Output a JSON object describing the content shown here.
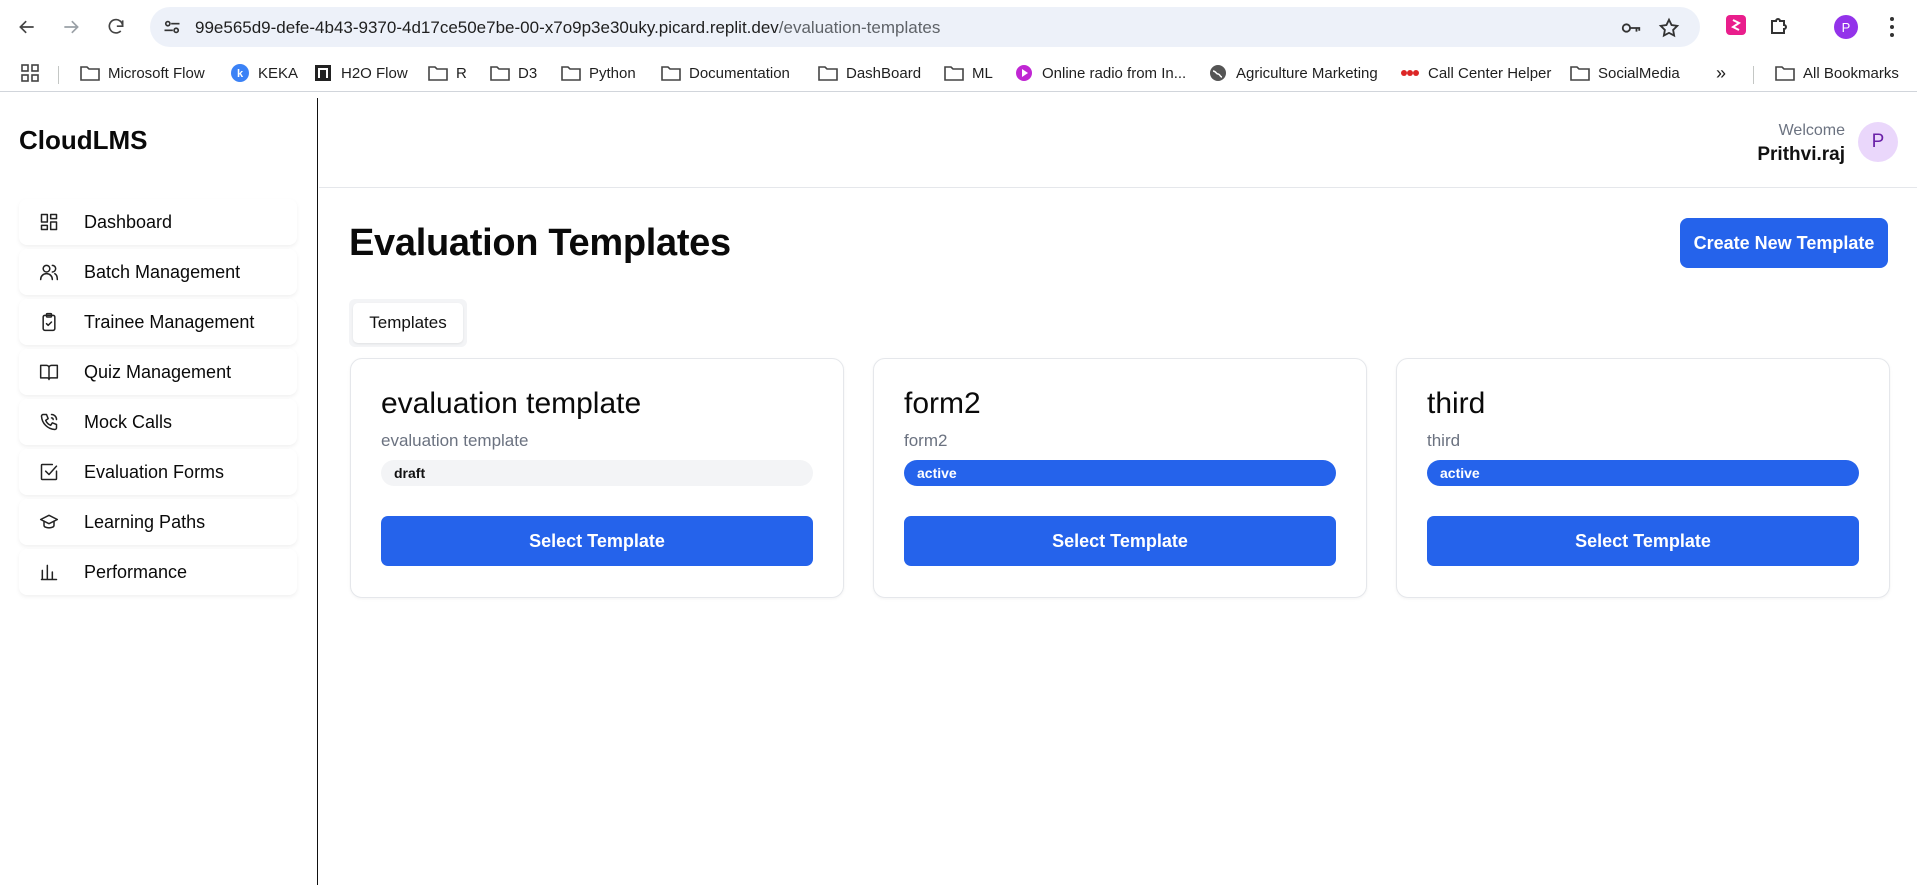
{
  "browser": {
    "url_host": "99e565d9-defe-4b43-9370-4d17ce50e7be-00-x7o9p3e30uky.picard.replit.dev",
    "url_path": "/evaluation-templates",
    "profile_initial": "P",
    "bookmarks": [
      {
        "label": "Microsoft Flow",
        "icon": "folder-icon"
      },
      {
        "label": "KEKA",
        "icon": "keka-icon"
      },
      {
        "label": "H2O Flow",
        "icon": "h2o-icon"
      },
      {
        "label": "R",
        "icon": "folder-icon"
      },
      {
        "label": "D3",
        "icon": "folder-icon"
      },
      {
        "label": "Python",
        "icon": "folder-icon"
      },
      {
        "label": "Documentation",
        "icon": "folder-icon"
      },
      {
        "label": "DashBoard",
        "icon": "folder-icon"
      },
      {
        "label": "ML",
        "icon": "folder-icon"
      },
      {
        "label": "Online radio from In...",
        "icon": "radio-icon"
      },
      {
        "label": "Agriculture Marketing",
        "icon": "globe-icon"
      },
      {
        "label": "Call Center Helper",
        "icon": "callcenter-icon"
      },
      {
        "label": "SocialMedia",
        "icon": "folder-icon"
      }
    ],
    "all_bookmarks": "All Bookmarks",
    "accent_color": "#2563eb"
  },
  "app": {
    "brand": "CloudLMS",
    "nav": [
      {
        "label": "Dashboard",
        "icon": "grid-icon"
      },
      {
        "label": "Batch Management",
        "icon": "users-icon"
      },
      {
        "label": "Trainee Management",
        "icon": "clipboard-icon"
      },
      {
        "label": "Quiz Management",
        "icon": "book-icon"
      },
      {
        "label": "Mock Calls",
        "icon": "phone-icon"
      },
      {
        "label": "Evaluation Forms",
        "icon": "checkbox-icon"
      },
      {
        "label": "Learning Paths",
        "icon": "graduation-cap-icon"
      },
      {
        "label": "Performance",
        "icon": "bar-chart-icon"
      }
    ],
    "header": {
      "welcome": "Welcome",
      "user_name": "Prithvi.raj",
      "avatar_initial": "P"
    },
    "page_title": "Evaluation Templates",
    "create_button": "Create New Template",
    "tabs": [
      {
        "label": "Templates"
      }
    ],
    "cards": [
      {
        "title": "evaluation template",
        "subtitle": "evaluation template",
        "status": "draft",
        "button": "Select Template"
      },
      {
        "title": "form2",
        "subtitle": "form2",
        "status": "active",
        "button": "Select Template"
      },
      {
        "title": "third",
        "subtitle": "third",
        "status": "active",
        "button": "Select Template"
      }
    ]
  }
}
